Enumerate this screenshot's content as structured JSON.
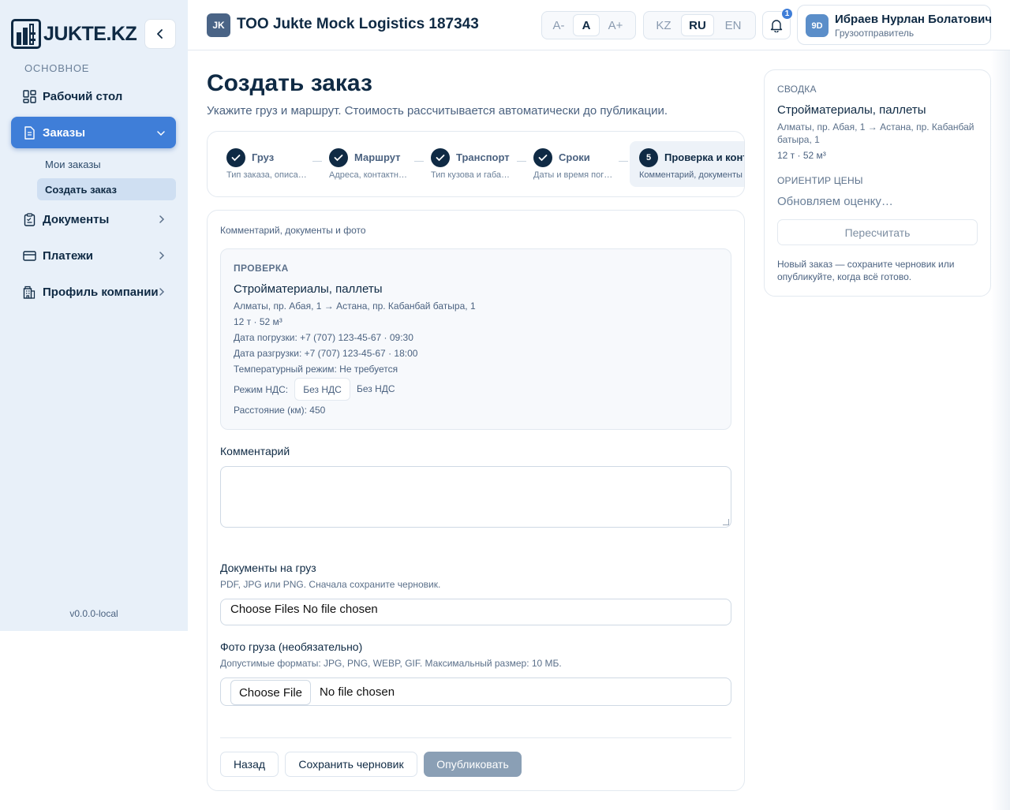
{
  "sidebar": {
    "logo_text": "JUKTE.KZ",
    "section_label": "ОСНОВНОЕ",
    "items": [
      {
        "label": "Рабочий стол",
        "icon": "dashboard-icon"
      },
      {
        "label": "Заказы",
        "icon": "document-icon"
      },
      {
        "label": "Документы",
        "icon": "clipboard-icon"
      },
      {
        "label": "Платежи",
        "icon": "card-icon"
      },
      {
        "label": "Профиль компании",
        "icon": "building-icon"
      }
    ],
    "sub_items": [
      "Мои заказы",
      "Создать заказ"
    ],
    "version": "v0.0.0-local"
  },
  "header": {
    "org_initials": "JK",
    "org_name": "ТОО Jukte Mock Logistics 187343",
    "font_sizes": [
      "A-",
      "A",
      "A+"
    ],
    "languages": [
      "KZ",
      "RU",
      "EN"
    ],
    "notifications_count": "1",
    "user_initials": "9D",
    "user_name": "Ибраев Нурлан Болатович",
    "user_role": "Грузоотправитель"
  },
  "page": {
    "title": "Создать заказ",
    "subtitle": "Укажите груз и маршрут. Стоимость рассчитывается автоматически до публикации."
  },
  "steps": [
    {
      "title": "Груз",
      "desc": "Тип заказа, описание груза"
    },
    {
      "title": "Маршрут",
      "desc": "Адреса, контактные лица"
    },
    {
      "title": "Транспорт",
      "desc": "Тип кузова и габариты"
    },
    {
      "title": "Сроки",
      "desc": "Даты и время погрузки"
    },
    {
      "number": "5",
      "title": "Проверка и контакты",
      "desc": "Комментарий, документы и фото"
    }
  ],
  "form": {
    "caption": "Комментарий, документы и фото",
    "review": {
      "label": "ПРОВЕРКА",
      "title": "Стройматериалы, паллеты",
      "route": "Алматы, пр. Абая, 1 → Астана, пр. Кабанбай батыра, 1",
      "dims": "12 т · 52 м³",
      "loading": "Дата погрузки: +7 (707) 123-45-67 · 09:30",
      "unloading": "Дата разгрузки: +7 (707) 123-45-67 · 18:00",
      "temperature": "Температурный режим: Не требуется",
      "vat_label": "Режим НДС:",
      "vat_pill": "Без НДС",
      "vat_value": "Без НДС",
      "distance": "Расстояние (км): 450"
    },
    "comment_label": "Комментарий",
    "comment_value": "",
    "docs_label": "Документы на груз",
    "docs_hint": "PDF, JPG или PNG. Сначала сохраните черновик.",
    "docs_input": "Choose Files No file chosen",
    "photo_label": "Фото груза (необязательно)",
    "photo_hint": "Допустимые форматы: JPG, PNG, WEBP, GIF. Максимальный размер: 10 МБ.",
    "photo_choose": "Choose File",
    "photo_status": "No file chosen",
    "back_label": "Назад",
    "draft_label": "Сохранить черновик",
    "publish_label": "Опубликовать"
  },
  "summary": {
    "label": "СВОДКА",
    "title": "Стройматериалы, паллеты",
    "route": "Алматы, пр. Абая, 1 → Астана, пр. Кабанбай батыра, 1",
    "dims": "12 т · 52 м³",
    "price_label": "ОРИЕНТИР ЦЕНЫ",
    "price_status": "Обновляем оценку…",
    "recalc_label": "Пересчитать",
    "note": "Новый заказ — сохраните черновик или опубликуйте, когда всё готово."
  },
  "colors": {
    "accent": "#3f7ed8",
    "primary_dark": "#0f2a44",
    "sidebar_bg": "#e8f0f9"
  }
}
